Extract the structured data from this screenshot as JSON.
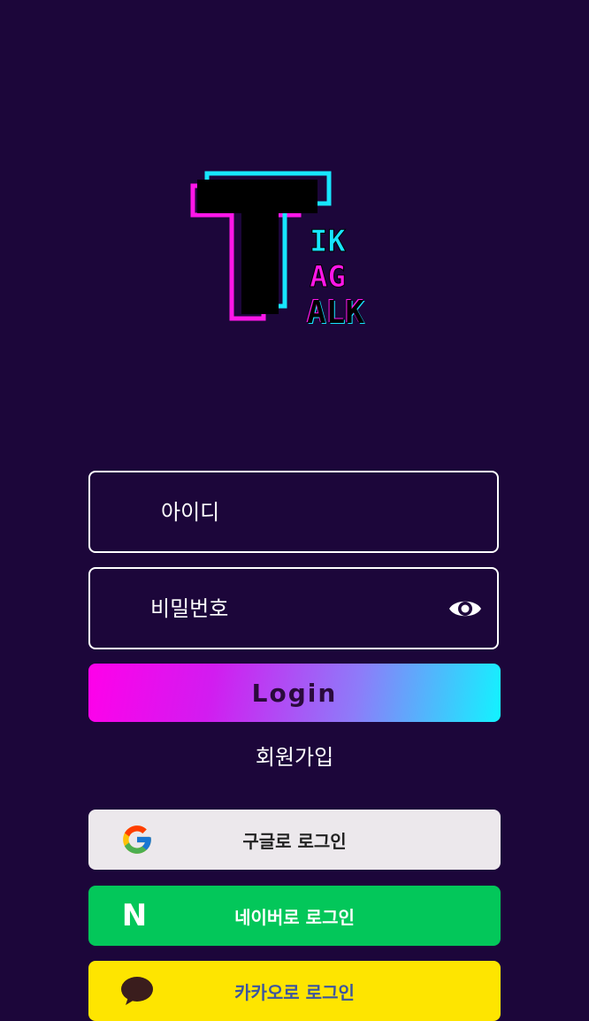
{
  "logo": {
    "name": "TIK TAG TALK",
    "letters": {
      "big": "T",
      "row1": "IK",
      "row2": "AG",
      "row3": "ALK"
    }
  },
  "form": {
    "id_placeholder": "아이디",
    "password_placeholder": "비밀번호",
    "login_label": "Login",
    "signup_label": "회원가입"
  },
  "social": {
    "google_label": "구글로 로그인",
    "naver_label": "네이버로 로그인",
    "kakao_label": "카카오로 로그인",
    "naver_icon_letter": "N"
  },
  "colors": {
    "background": "#1c063a",
    "gradient_start": "#ff00ea",
    "gradient_end": "#12f3ff",
    "google_bg": "#ece8ec",
    "naver_bg": "#03c75a",
    "kakao_bg": "#fee500"
  },
  "icons": [
    "eye-icon",
    "google-icon",
    "naver-icon",
    "kakao-icon"
  ]
}
